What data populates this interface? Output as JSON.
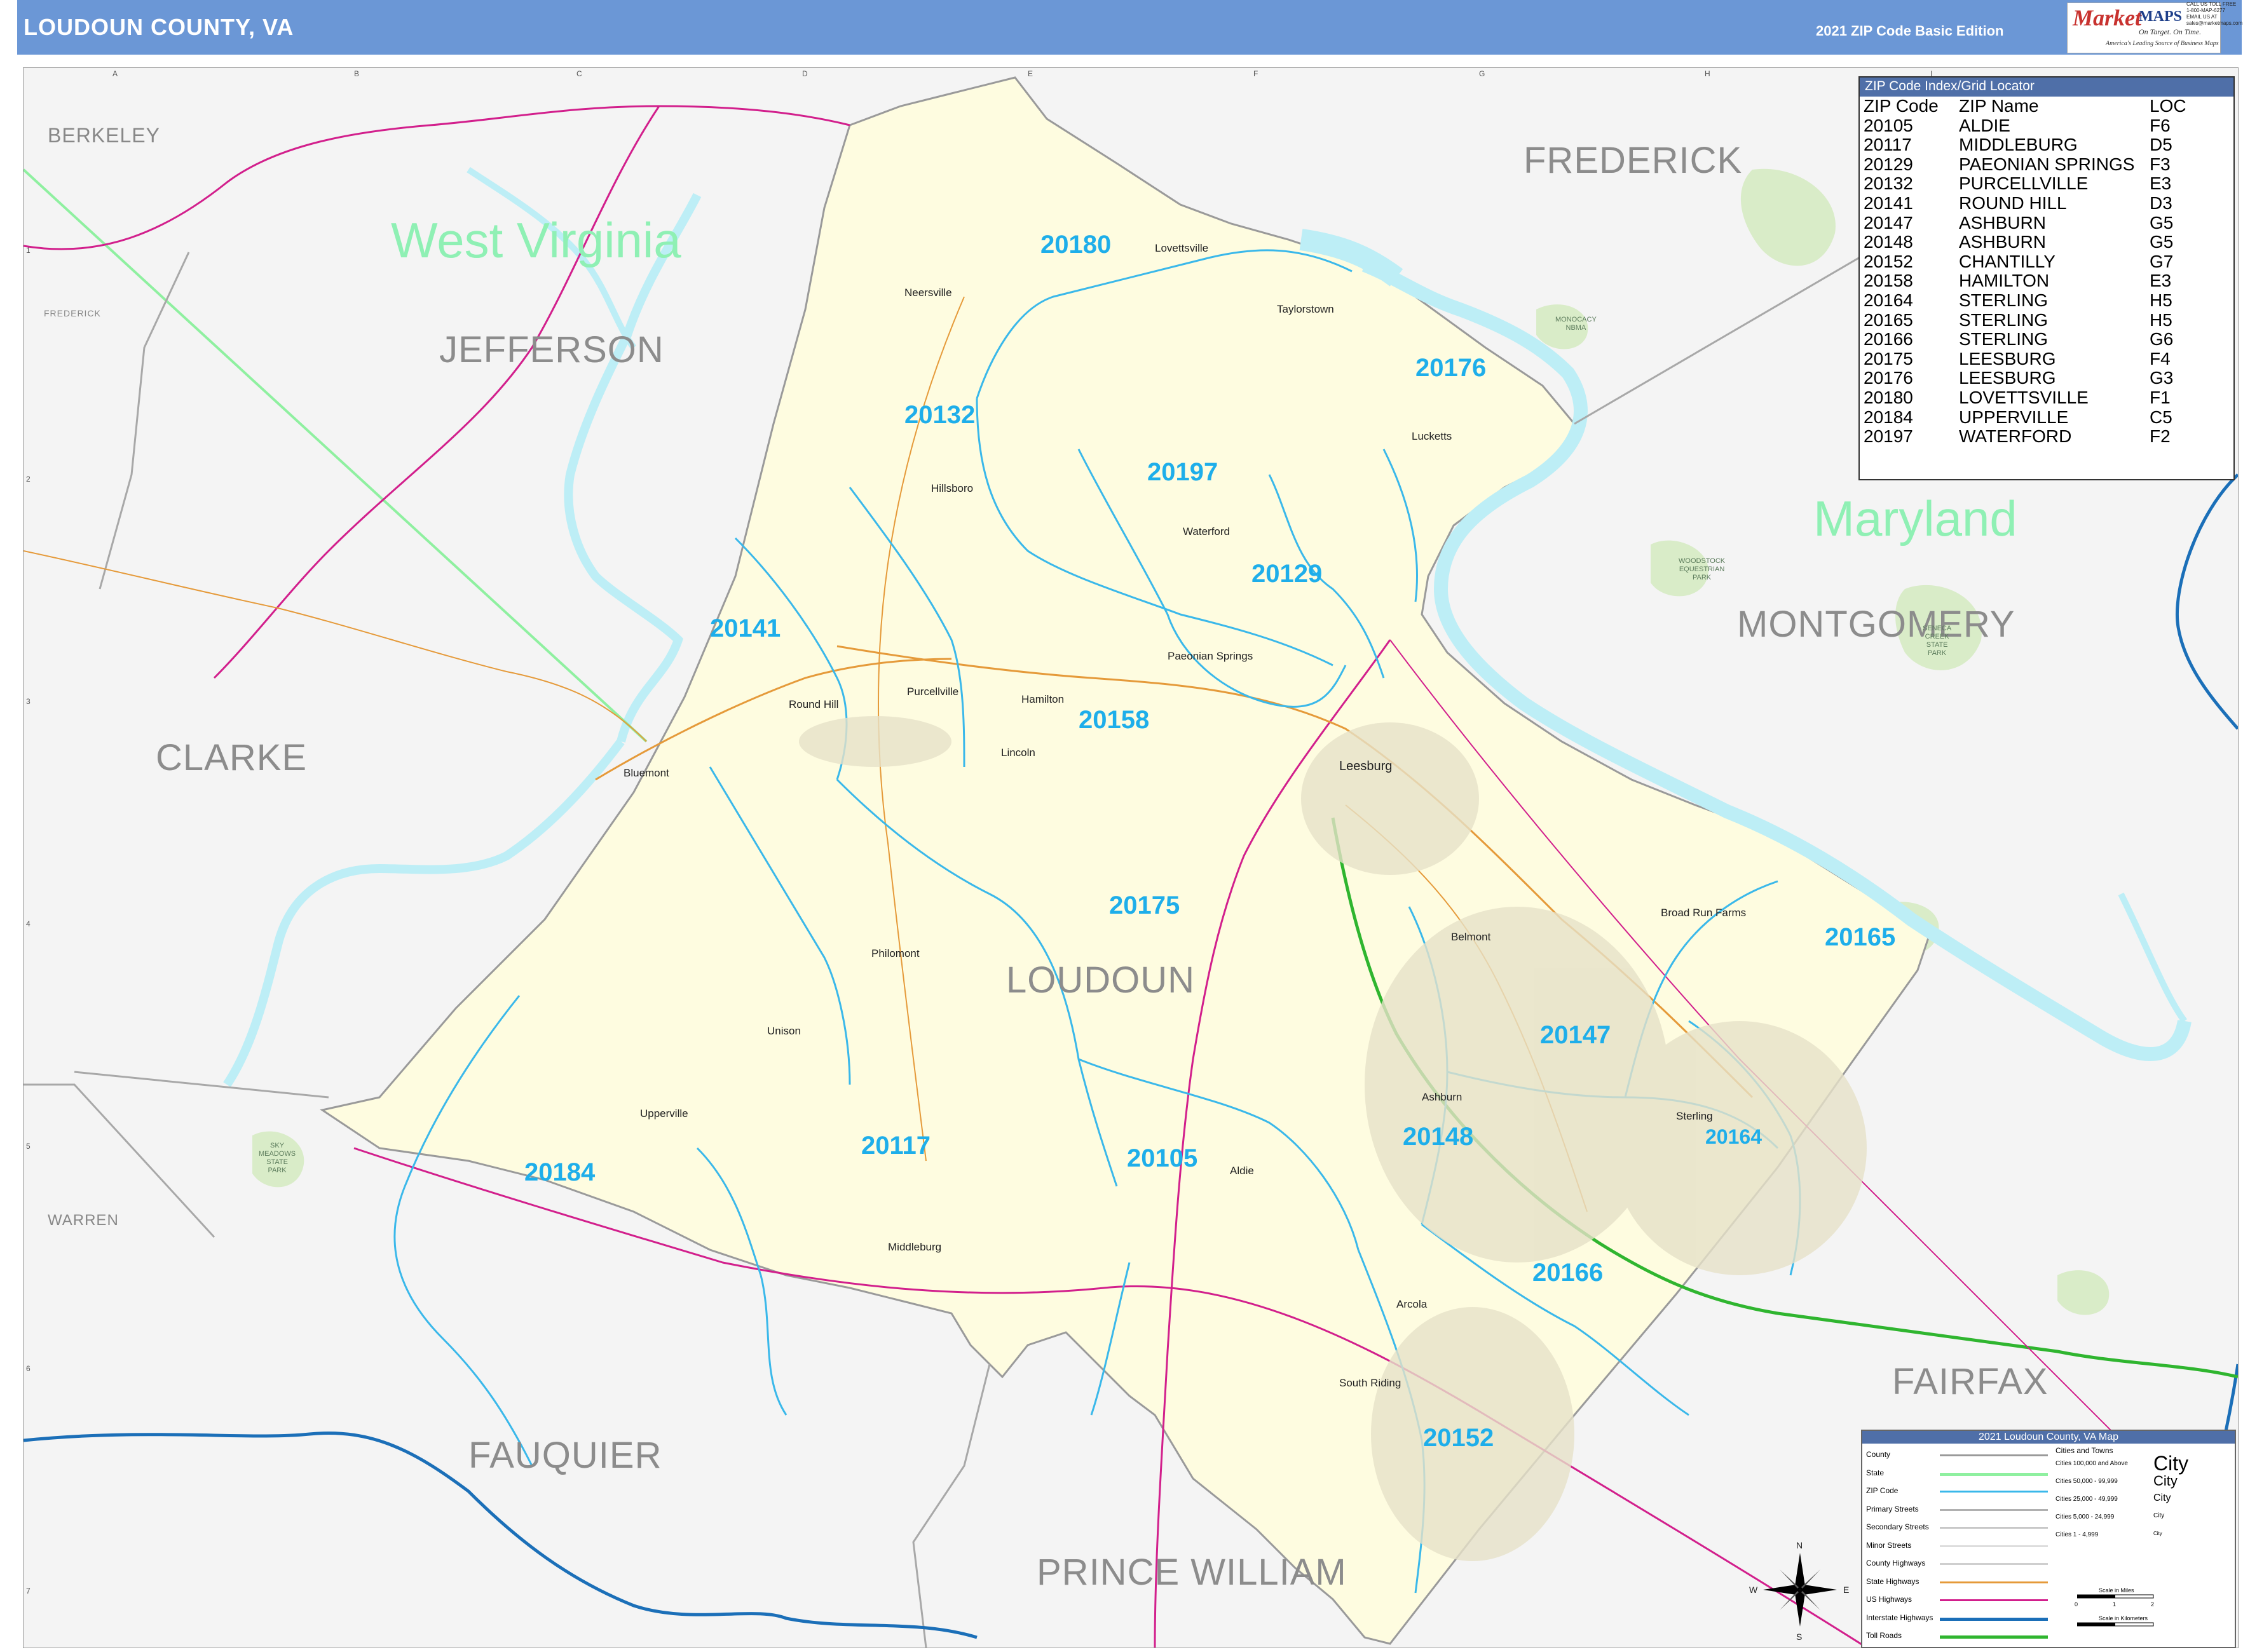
{
  "header": {
    "title": "LOUDOUN COUNTY, VA",
    "edition": "2021 ZIP Code Basic Edition",
    "logo": {
      "brand_a": "Market",
      "brand_b": "MAPS",
      "tagline_1": "On Target. On Time.",
      "tagline_2": "America's Leading Source of Business Maps",
      "contact": [
        "CALL US TOLL FREE",
        "1-800-MAP-6277",
        "EMAIL US AT",
        "sales@marketmaps.com"
      ]
    }
  },
  "grid": {
    "columns": [
      "A",
      "B",
      "C",
      "D",
      "E",
      "F",
      "G",
      "H",
      "I"
    ],
    "rows": [
      "1",
      "2",
      "3",
      "4",
      "5",
      "6",
      "7"
    ]
  },
  "regions": {
    "berkeley": "BERKELEY",
    "frederick_md": "FREDERICK",
    "frederick_wv": "FREDERICK",
    "jefferson": "JEFFERSON",
    "clarke": "CLARKE",
    "loudoun": "LOUDOUN",
    "montgomery": "MONTGOMERY",
    "warren": "WARREN",
    "fauquier": "FAUQUIER",
    "prince_william": "PRINCE WILLIAM",
    "fairfax": "FAIRFAX"
  },
  "states": {
    "west_virginia": "West Virginia",
    "maryland": "Maryland"
  },
  "zip_labels": {
    "z20180": "20180",
    "z20176": "20176",
    "z20132": "20132",
    "z20197": "20197",
    "z20129": "20129",
    "z20141": "20141",
    "z20158": "20158",
    "z20175": "20175",
    "z20165": "20165",
    "z20147": "20147",
    "z20148": "20148",
    "z20164": "20164",
    "z20117": "20117",
    "z20105": "20105",
    "z20184": "20184",
    "z20166": "20166",
    "z20152": "20152"
  },
  "cities": {
    "leesburg": "Leesburg",
    "round_hill": "Round Hill",
    "purcellville": "Purcellville",
    "hamilton": "Hamilton",
    "lovettsville": "Lovettsville",
    "waterford": "Waterford",
    "hillsboro": "Hillsboro",
    "bluemont": "Bluemont",
    "aldie": "Aldie",
    "middleburg": "Middleburg",
    "upperville": "Upperville",
    "philomont": "Philomont",
    "lincoln": "Lincoln",
    "unison": "Unison",
    "ashburn": "Ashburn",
    "sterling": "Sterling",
    "arcola": "Arcola",
    "lucketts": "Lucketts",
    "taylorstown": "Taylorstown",
    "paeonian_springs": "Paeonian Springs",
    "neersville": "Neersville",
    "broad_run_farms": "Broad Run Farms",
    "belmont": "Belmont",
    "south_riding": "South Riding"
  },
  "parks": {
    "seneca": "SENECA\nCREEK\nSTATE\nPARK",
    "woodstock": "WOODSTOCK\nEQUESTRIAN\nPARK",
    "monocacy": "MONOCACY\nNBMA",
    "sky_meadows": "SKY\nMEADOWS\nSTATE\nPARK"
  },
  "zip_index": {
    "title": "ZIP Code Index/Grid Locator",
    "headers": [
      "ZIP Code",
      "ZIP Name",
      "LOC"
    ],
    "rows": [
      [
        "20105",
        "ALDIE",
        "F6"
      ],
      [
        "20117",
        "MIDDLEBURG",
        "D5"
      ],
      [
        "20129",
        "PAEONIAN SPRINGS",
        "F3"
      ],
      [
        "20132",
        "PURCELLVILLE",
        "E3"
      ],
      [
        "20141",
        "ROUND HILL",
        "D3"
      ],
      [
        "20147",
        "ASHBURN",
        "G5"
      ],
      [
        "20148",
        "ASHBURN",
        "G5"
      ],
      [
        "20152",
        "CHANTILLY",
        "G7"
      ],
      [
        "20158",
        "HAMILTON",
        "E3"
      ],
      [
        "20164",
        "STERLING",
        "H5"
      ],
      [
        "20165",
        "STERLING",
        "H5"
      ],
      [
        "20166",
        "STERLING",
        "G6"
      ],
      [
        "20175",
        "LEESBURG",
        "F4"
      ],
      [
        "20176",
        "LEESBURG",
        "G3"
      ],
      [
        "20180",
        "LOVETTSVILLE",
        "F1"
      ],
      [
        "20184",
        "UPPERVILLE",
        "C5"
      ],
      [
        "20197",
        "WATERFORD",
        "F2"
      ]
    ]
  },
  "legend": {
    "title": "2021 Loudoun County, VA Map",
    "items": [
      "County",
      "State",
      "ZIP Code",
      "Primary Streets",
      "Secondary Streets",
      "Minor Streets",
      "County Highways",
      "State Highways",
      "US Highways",
      "Interstate Highways",
      "Toll Roads"
    ],
    "colors": {
      "County": "#9a9a9a",
      "State": "#8ff0a0",
      "ZIP Code": "#3ab8ea",
      "Primary Streets": "#b0b0b0",
      "Secondary Streets": "#c8c8c8",
      "Minor Streets": "#dddddd",
      "County Highways": "#cfcfcf",
      "State Highways": "#e59a3a",
      "US Highways": "#d21f8c",
      "Interstate Highways": "#1b6fb8",
      "Toll Roads": "#2fb52f"
    },
    "cities_header": "Cities and Towns",
    "city_sizes": [
      {
        "range": "Cities 100,000 and Above",
        "sample": "City"
      },
      {
        "range": "Cities 50,000 - 99,999",
        "sample": "City"
      },
      {
        "range": "Cities 25,000 - 49,999",
        "sample": "City"
      },
      {
        "range": "Cities 5,000 - 24,999",
        "sample": "City"
      },
      {
        "range": "Cities 1 - 4,999",
        "sample": "City"
      }
    ],
    "scale_miles": "Scale in Miles",
    "scale_km": "Scale in Kilometers",
    "scale_ticks": [
      "0",
      "1",
      "2"
    ],
    "compass": {
      "n": "N",
      "s": "S",
      "e": "E",
      "w": "W"
    }
  },
  "colors": {
    "county_fill": "#fefce0",
    "outside_fill": "#f4f4f4",
    "water": "#bdeef6",
    "park": "#d9ecc8",
    "zip_boundary": "#3ab8ea",
    "header": "#6b97d6"
  }
}
